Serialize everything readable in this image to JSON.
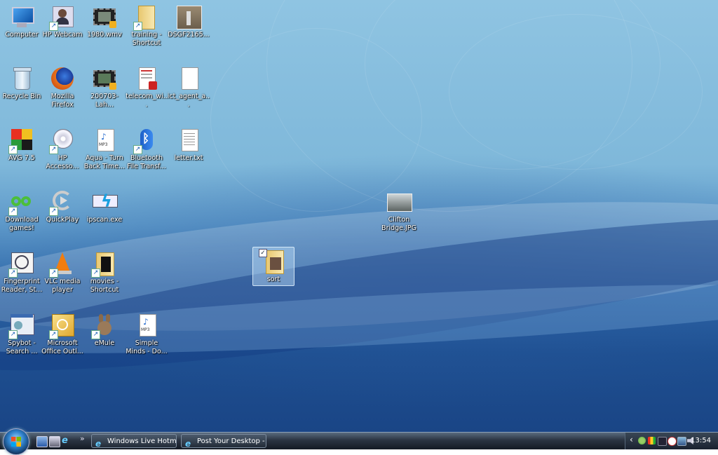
{
  "desktop": {
    "icons": [
      {
        "label": "Computer"
      },
      {
        "label": "HP Webcam"
      },
      {
        "label": "1980.wmv"
      },
      {
        "label": "training - Shortcut"
      },
      {
        "label": "DSGF2165..."
      },
      {
        "label": "Recycle Bin"
      },
      {
        "label": "Mozilla Firefox"
      },
      {
        "label": "200703-Lah..."
      },
      {
        "label": "telecom_wi..."
      },
      {
        "label": "ict_agent_a..."
      },
      {
        "label": "AVG 7.5"
      },
      {
        "label": "HP Accesso..."
      },
      {
        "label": "Aqua - Turn Back Time..."
      },
      {
        "label": "Bluetooth File Transf..."
      },
      {
        "label": "letter.txt"
      },
      {
        "label": "Download games!"
      },
      {
        "label": "QuickPlay"
      },
      {
        "label": "ipscan.exe"
      },
      {
        "label": "Fingerprint Reader, St..."
      },
      {
        "label": "VLC media player"
      },
      {
        "label": "movies - Shortcut"
      },
      {
        "label": "Spybot - Search ..."
      },
      {
        "label": "Microsoft Office Outl..."
      },
      {
        "label": "eMule"
      },
      {
        "label": "Simple Minds - Do..."
      },
      {
        "label": "Clifton Bridge.JPG"
      },
      {
        "label": "sort"
      }
    ],
    "mp3_badge": "MP3"
  },
  "taskbar": {
    "overflow_chevron": "»",
    "buttons": [
      {
        "label": "Windows Live Hotm..."
      },
      {
        "label": "Post Your Desktop - ..."
      }
    ],
    "tray_expand": "‹",
    "clock": "13:54"
  },
  "colors": {
    "accent": "#1e4f90",
    "taskbar": "#1a2230",
    "label_text": "#ffffff"
  }
}
